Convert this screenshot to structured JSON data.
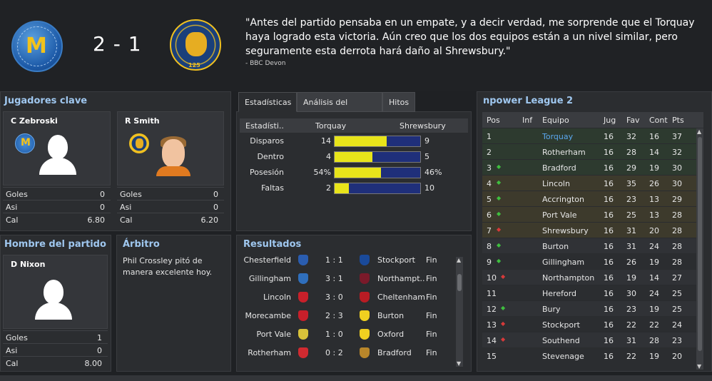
{
  "match": {
    "score": "2 - 1",
    "quote": "\"Antes del partido pensaba en un empate, y a decir verdad, me sorprende que el Torquay haya logrado esta victoria. Aún creo que los dos equipos están a un nivel similar, pero seguramente esta derrota hará daño al Shrewsbury.\"",
    "quote_source": "- BBC Devon",
    "home_crest_icon": "torquay-united-crest-icon",
    "away_crest_icon": "shrewsbury-town-crest-icon"
  },
  "key_players": {
    "title": "Jugadores clave",
    "players": [
      {
        "name": "C Zebroski",
        "rows": [
          {
            "label": "Goles",
            "value": "0"
          },
          {
            "label": "Asi",
            "value": "0"
          },
          {
            "label": "Cal",
            "value": "6.80"
          }
        ]
      },
      {
        "name": "R Smith",
        "rows": [
          {
            "label": "Goles",
            "value": "0"
          },
          {
            "label": "Asi",
            "value": "0"
          },
          {
            "label": "Cal",
            "value": "6.20"
          }
        ]
      }
    ]
  },
  "man_of_match": {
    "title": "Hombre del partido",
    "name": "D Nixon",
    "rows": [
      {
        "label": "Goles",
        "value": "1"
      },
      {
        "label": "Asi",
        "value": "0"
      },
      {
        "label": "Cal",
        "value": "8.00"
      }
    ]
  },
  "referee": {
    "title": "Árbitro",
    "text": "Phil Crossley pitó de manera excelente hoy."
  },
  "tabs": [
    {
      "label": "Estadísticas",
      "active": true
    },
    {
      "label": "Análisis del Partido",
      "active": false
    },
    {
      "label": "Hitos",
      "active": false
    }
  ],
  "stats": {
    "headers": {
      "stat": "Estadísti..",
      "home": "Torquay",
      "away": "Shrewsbury"
    },
    "rows": [
      {
        "label": "Disparos",
        "home": "14",
        "away": "9",
        "home_share": 0.609
      },
      {
        "label": "Dentro",
        "home": "4",
        "away": "5",
        "home_share": 0.444
      },
      {
        "label": "Posesión",
        "home": "54%",
        "away": "46%",
        "home_share": 0.54
      },
      {
        "label": "Faltas",
        "home": "2",
        "away": "10",
        "home_share": 0.167
      }
    ]
  },
  "results": {
    "title": "Resultados",
    "rows": [
      {
        "home": "Chesterfield",
        "score": "1 : 1",
        "away": "Stockport",
        "status": "Fin",
        "hc": "#2a5db0",
        "ac": "#1a4a9a"
      },
      {
        "home": "Gillingham",
        "score": "3 : 1",
        "away": "Northampt..",
        "status": "Fin",
        "hc": "#2f6fbd",
        "ac": "#7a1a2a"
      },
      {
        "home": "Lincoln",
        "score": "3 : 0",
        "away": "Cheltenham",
        "status": "Fin",
        "hc": "#c8202a",
        "ac": "#b81c24"
      },
      {
        "home": "Morecambe",
        "score": "2 : 3",
        "away": "Burton",
        "status": "Fin",
        "hc": "#c81f2a",
        "ac": "#f0d020"
      },
      {
        "home": "Port Vale",
        "score": "1 : 0",
        "away": "Oxford",
        "status": "Fin",
        "hc": "#d8c23a",
        "ac": "#f0d020"
      },
      {
        "home": "Rotherham",
        "score": "0 : 2",
        "away": "Bradford",
        "status": "Fin",
        "hc": "#d02a30",
        "ac": "#b8862a"
      }
    ]
  },
  "league": {
    "title": "npower League 2",
    "headers": {
      "pos": "Pos",
      "inf": "Inf",
      "team": "Equipo",
      "jug": "Jug",
      "fav": "Fav",
      "cont": "Cont",
      "pts": "Pts"
    },
    "rows": [
      {
        "pos": "1",
        "trend": "",
        "team": "Torquay",
        "jug": "16",
        "fav": "32",
        "cont": "16",
        "pts": "37",
        "zone": "promo",
        "highlight": true
      },
      {
        "pos": "2",
        "trend": "",
        "team": "Rotherham",
        "jug": "16",
        "fav": "28",
        "cont": "14",
        "pts": "32",
        "zone": "promo",
        "highlight": false
      },
      {
        "pos": "3",
        "trend": "up",
        "team": "Bradford",
        "jug": "16",
        "fav": "29",
        "cont": "19",
        "pts": "30",
        "zone": "promo",
        "highlight": false
      },
      {
        "pos": "4",
        "trend": "up",
        "team": "Lincoln",
        "jug": "16",
        "fav": "35",
        "cont": "26",
        "pts": "30",
        "zone": "playoff",
        "highlight": false
      },
      {
        "pos": "5",
        "trend": "up",
        "team": "Accrington",
        "jug": "16",
        "fav": "23",
        "cont": "13",
        "pts": "29",
        "zone": "playoff",
        "highlight": false
      },
      {
        "pos": "6",
        "trend": "up",
        "team": "Port Vale",
        "jug": "16",
        "fav": "25",
        "cont": "13",
        "pts": "28",
        "zone": "playoff",
        "highlight": false
      },
      {
        "pos": "7",
        "trend": "down",
        "team": "Shrewsbury",
        "jug": "16",
        "fav": "31",
        "cont": "20",
        "pts": "28",
        "zone": "playoff",
        "highlight": false
      },
      {
        "pos": "8",
        "trend": "up",
        "team": "Burton",
        "jug": "16",
        "fav": "31",
        "cont": "24",
        "pts": "28",
        "zone": "",
        "highlight": false
      },
      {
        "pos": "9",
        "trend": "up",
        "team": "Gillingham",
        "jug": "16",
        "fav": "26",
        "cont": "19",
        "pts": "28",
        "zone": "",
        "highlight": false
      },
      {
        "pos": "10",
        "trend": "down",
        "team": "Northampton",
        "jug": "16",
        "fav": "19",
        "cont": "14",
        "pts": "27",
        "zone": "",
        "highlight": false
      },
      {
        "pos": "11",
        "trend": "",
        "team": "Hereford",
        "jug": "16",
        "fav": "30",
        "cont": "24",
        "pts": "25",
        "zone": "",
        "highlight": false
      },
      {
        "pos": "12",
        "trend": "up",
        "team": "Bury",
        "jug": "16",
        "fav": "23",
        "cont": "19",
        "pts": "25",
        "zone": "",
        "highlight": false
      },
      {
        "pos": "13",
        "trend": "down",
        "team": "Stockport",
        "jug": "16",
        "fav": "22",
        "cont": "22",
        "pts": "24",
        "zone": "",
        "highlight": false
      },
      {
        "pos": "14",
        "trend": "down",
        "team": "Southend",
        "jug": "16",
        "fav": "31",
        "cont": "28",
        "pts": "23",
        "zone": "",
        "highlight": false
      },
      {
        "pos": "15",
        "trend": "",
        "team": "Stevenage",
        "jug": "16",
        "fav": "22",
        "cont": "19",
        "pts": "20",
        "zone": "",
        "highlight": false
      }
    ]
  },
  "colors": {
    "accent_title": "#9fc7ef",
    "promo_zone": "#2d3a2f",
    "playoff_zone": "#3d3a2c",
    "trend_up": "#3fbf3f",
    "trend_down": "#d83a3a",
    "highlight_team": "#5aa7ee"
  }
}
